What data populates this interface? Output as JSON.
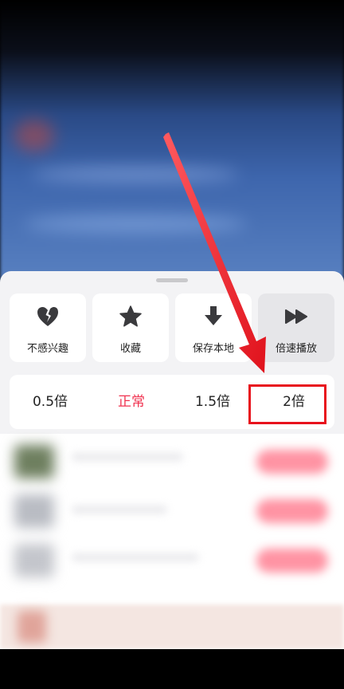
{
  "actions": [
    {
      "label": "不感兴趣",
      "icon": "broken-heart-icon"
    },
    {
      "label": "收藏",
      "icon": "star-icon"
    },
    {
      "label": "保存本地",
      "icon": "download-icon"
    },
    {
      "label": "倍速播放",
      "icon": "fast-forward-icon"
    }
  ],
  "speeds": [
    {
      "label": "0.5倍",
      "selected": false
    },
    {
      "label": "正常",
      "selected": true
    },
    {
      "label": "1.5倍",
      "selected": false
    },
    {
      "label": "2倍",
      "selected": false
    }
  ],
  "colors": {
    "accent": "#f0324f",
    "annotation_red": "#e8121d",
    "sheet_bg": "#f3f3f5",
    "active_tile": "#e6e6e9"
  }
}
